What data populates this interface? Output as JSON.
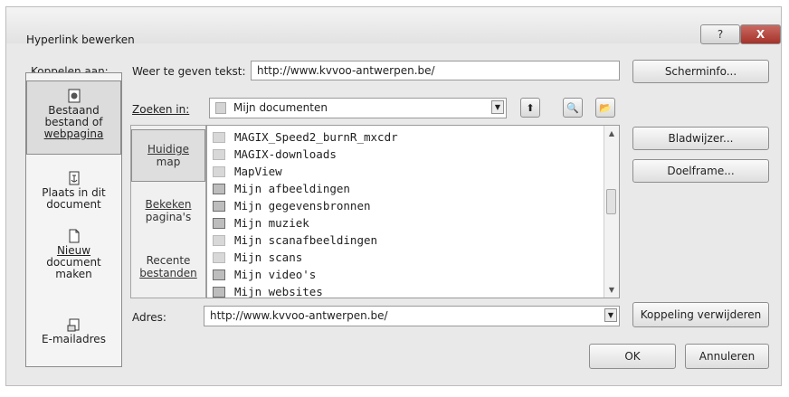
{
  "window": {
    "title": "Hyperlink bewerken",
    "help_label": "?",
    "close_label": "X"
  },
  "link_to": {
    "label": "Koppelen aan:",
    "items": [
      {
        "label_lines": [
          "Bestaand",
          "bestand of",
          "webpagina"
        ],
        "selected": true,
        "icon": "globe-document-icon"
      },
      {
        "label_lines": [
          "Plaats in dit",
          "document"
        ],
        "selected": false,
        "icon": "document-anchor-icon"
      },
      {
        "label_lines": [
          "Nieuw",
          "document",
          "maken"
        ],
        "selected": false,
        "icon": "new-document-icon"
      },
      {
        "label_lines": [
          "E-mailadres"
        ],
        "selected": false,
        "icon": "email-icon"
      }
    ]
  },
  "display_text": {
    "label": "Weer te geven tekst:",
    "value": "http://www.kvvoo-antwerpen.be/"
  },
  "screentip_button": "Scherminfo...",
  "look_in": {
    "label": "Zoeken in:",
    "value": "Mijn documenten"
  },
  "sub_nav": {
    "items": [
      {
        "label_lines": [
          "Huidige",
          "map"
        ],
        "selected": true
      },
      {
        "label_lines": [
          "Bekeken",
          "pagina's"
        ],
        "selected": false
      },
      {
        "label_lines": [
          "Recente",
          "bestanden"
        ],
        "selected": false
      }
    ]
  },
  "files": [
    {
      "name": "MAGIX_Speed2_burnR_mxcdr",
      "icon": "folder"
    },
    {
      "name": "MAGIX-downloads",
      "icon": "folder"
    },
    {
      "name": "MapView",
      "icon": "folder"
    },
    {
      "name": "Mijn afbeeldingen",
      "icon": "special"
    },
    {
      "name": "Mijn gegevensbronnen",
      "icon": "special"
    },
    {
      "name": "Mijn muziek",
      "icon": "special"
    },
    {
      "name": "Mijn scanafbeeldingen",
      "icon": "folder"
    },
    {
      "name": "Mijn scans",
      "icon": "folder"
    },
    {
      "name": "Mijn video's",
      "icon": "special"
    },
    {
      "name": "Mijn websites",
      "icon": "special"
    }
  ],
  "right_buttons": {
    "bookmark": "Bladwijzer...",
    "target_frame": "Doelframe...",
    "remove_link": "Koppeling verwijderen"
  },
  "address": {
    "label": "Adres:",
    "value": "http://www.kvvoo-antwerpen.be/"
  },
  "footer": {
    "ok": "OK",
    "cancel": "Annuleren"
  }
}
